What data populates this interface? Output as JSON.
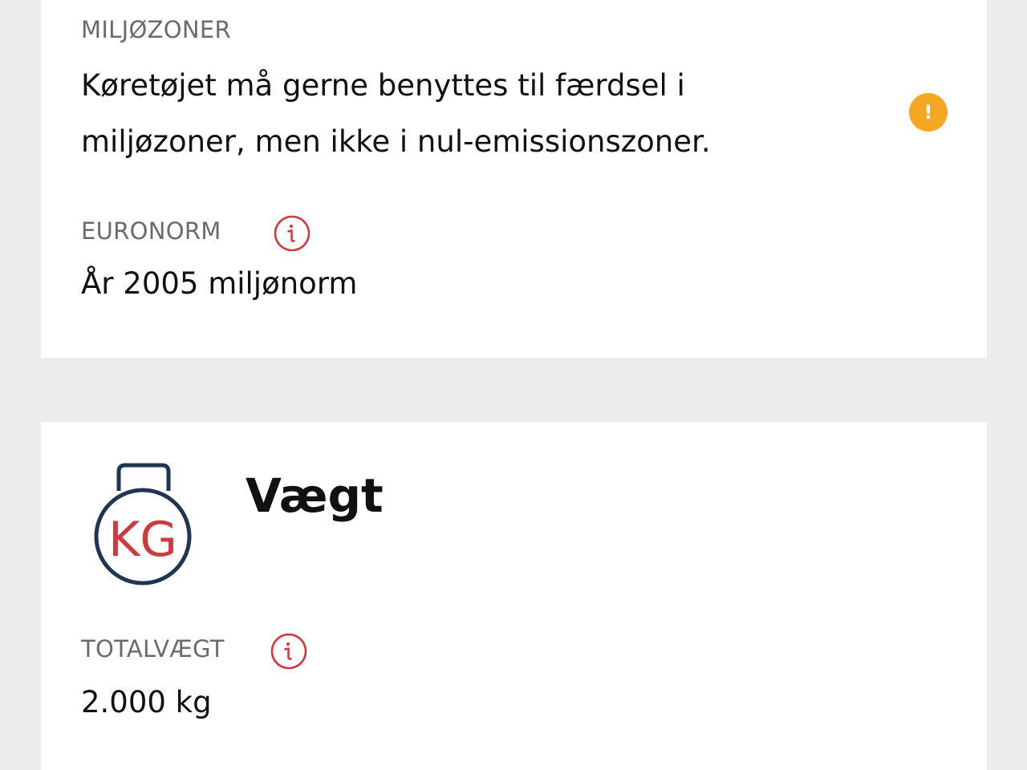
{
  "environment": {
    "label": "MILJØZONER",
    "description": "Køretøjet må gerne benyttes til færdsel i miljøzoner, men ikke i nul-emissionszoner.",
    "warning_symbol": "!",
    "warning_icon": "exclamation-circle-icon",
    "warning_color": "#f5a623",
    "euronorm": {
      "label": "EURONORM",
      "value": "År 2005 miljønorm",
      "info_icon": "info-circle-icon"
    }
  },
  "weight": {
    "title": "Vægt",
    "icon": "kettlebell-kg-icon",
    "icon_text": "KG",
    "total": {
      "label": "TOTALVÆGT",
      "value": "2.000 kg",
      "info_icon": "info-circle-icon"
    }
  },
  "colors": {
    "accent_red": "#d0393f",
    "icon_navy": "#1f3552",
    "label_gray": "#6b6b6b",
    "background": "#ececec"
  }
}
